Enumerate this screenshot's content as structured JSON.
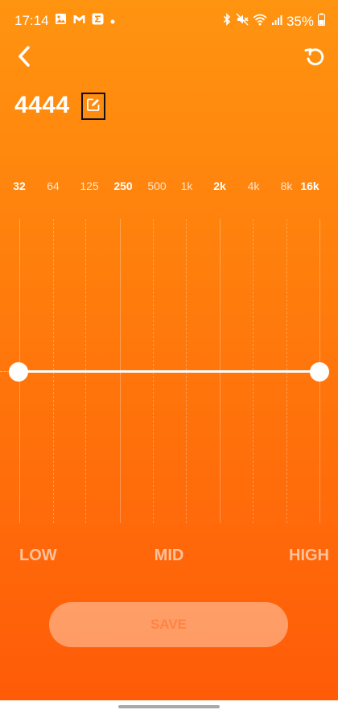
{
  "status_bar": {
    "time": "17:14",
    "battery": "35%",
    "icons_left": [
      "gallery-icon",
      "gmail-icon",
      "sigma-app-icon",
      "dot-icon"
    ],
    "icons_right": [
      "bluetooth-icon",
      "mute-icon",
      "wifi-icon",
      "signal-icon",
      "battery-icon"
    ]
  },
  "toolbar": {
    "back_icon": "back-arrow-icon",
    "reset_icon": "reset-icon"
  },
  "preset": {
    "name": "4444",
    "edit_icon": "edit-icon"
  },
  "equalizer": {
    "frequencies": [
      {
        "label": "32",
        "major": true
      },
      {
        "label": "64",
        "major": false
      },
      {
        "label": "125",
        "major": false
      },
      {
        "label": "250",
        "major": true
      },
      {
        "label": "500",
        "major": false
      },
      {
        "label": "1k",
        "major": false
      },
      {
        "label": "2k",
        "major": true
      },
      {
        "label": "4k",
        "major": false
      },
      {
        "label": "8k",
        "major": false
      },
      {
        "label": "16k",
        "major": true
      }
    ],
    "bands": {
      "low": "LOW",
      "mid": "MID",
      "high": "HIGH"
    },
    "gain_low": 0,
    "gain_high": 0
  },
  "actions": {
    "save_label": "SAVE"
  },
  "colors": {
    "background_top": "#ff9410",
    "background_bottom": "#ff5a08",
    "foreground": "#ffffff"
  }
}
